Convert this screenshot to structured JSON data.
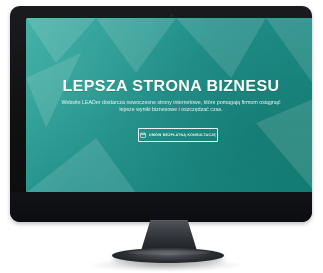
{
  "screen": {
    "hero": {
      "title": "LEPSZA STRONA BIZNESU",
      "subtitle": "Website LEADer dostarcza nowoczesne strony internetowe, które pomagają firmom osiągnąć lepsze wyniki biznesowe i oszczędzać czas.",
      "cta_label": "UMÓW BEZPŁATNĄ KONSULTACJĘ",
      "cta_icon": "calendar-icon"
    }
  },
  "colors": {
    "screen_accent": "#1f8f88",
    "screen_accent_dark": "#138177",
    "bezel": "#0f1012",
    "text_on_screen": "#ffffff"
  }
}
